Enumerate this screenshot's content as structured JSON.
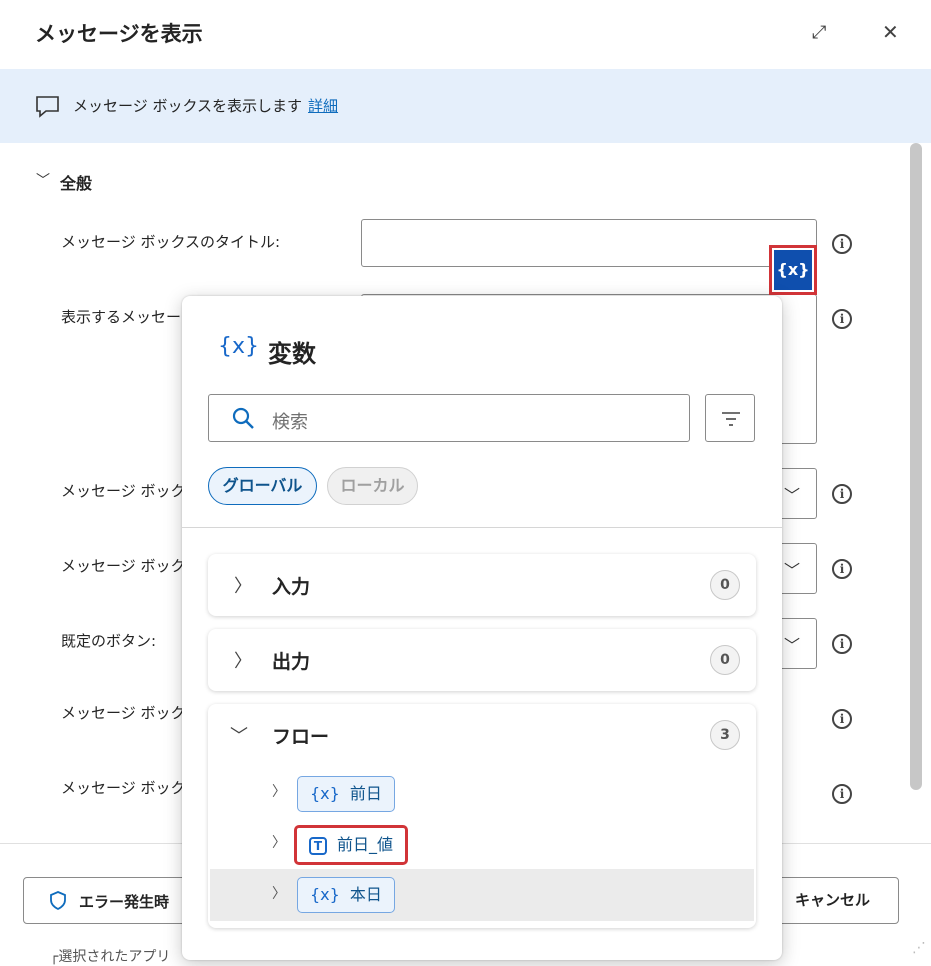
{
  "dialog": {
    "title": "メッセージを表示",
    "expand_icon": "⤢",
    "close_icon": "✕"
  },
  "banner": {
    "text": "メッセージ ボックスを表示します",
    "link": "詳細"
  },
  "section": {
    "label": "全般"
  },
  "fields": [
    {
      "label": "メッセージ ボックスのタイトル:"
    },
    {
      "label": "表示するメッセージ"
    },
    {
      "label": "メッセージ ボックス"
    },
    {
      "label": "メッセージ ボックス"
    },
    {
      "label": "既定のボタン:"
    },
    {
      "label": "メッセージ ボックス"
    },
    {
      "label": "メッセージ ボックス"
    }
  ],
  "footer": {
    "error_button": "エラー発生時",
    "cancel_button": "キャンセル",
    "behind_text": "┌選択されたアプリ"
  },
  "var_button": {
    "label": "{x}"
  },
  "var_panel": {
    "title": "変数",
    "title_icon": "{x}",
    "search_placeholder": "検索",
    "tabs": {
      "global": "グローバル",
      "local": "ローカル"
    },
    "groups": [
      {
        "name": "入力",
        "count": "0",
        "expanded": false
      },
      {
        "name": "出力",
        "count": "0",
        "expanded": false
      },
      {
        "name": "フロー",
        "count": "3",
        "expanded": true
      }
    ],
    "flow_variables": [
      {
        "name": "前日",
        "type_icon": "{x}"
      },
      {
        "name": "前日_値",
        "type_icon": "T"
      },
      {
        "name": "本日",
        "type_icon": "{x}"
      }
    ]
  },
  "colors": {
    "accent": "#0f6cbd",
    "highlight": "#d13438",
    "banner": "#e5effb"
  }
}
